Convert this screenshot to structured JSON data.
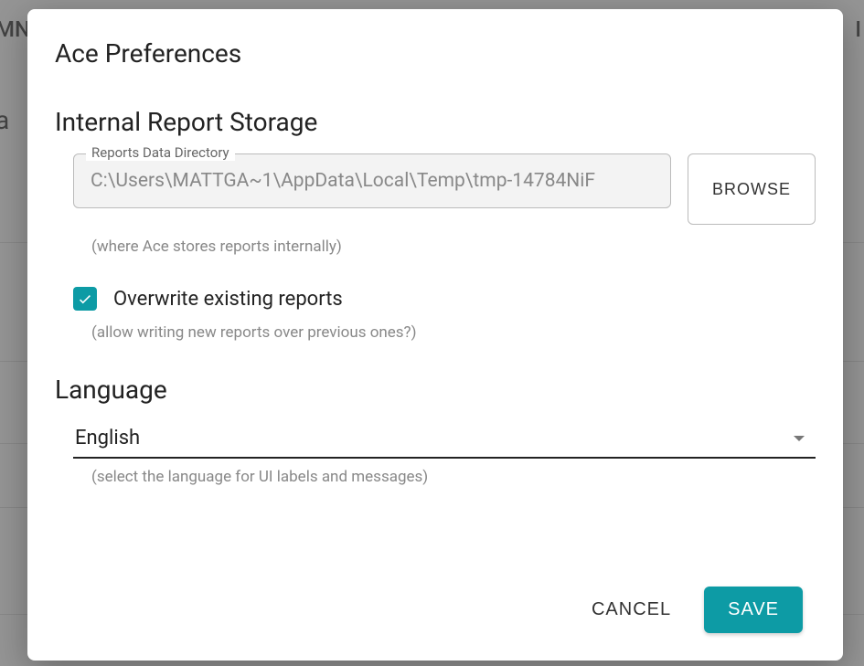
{
  "modal": {
    "title": "Ace Preferences",
    "storage": {
      "heading": "Internal Report Storage",
      "field_label": "Reports Data Directory",
      "directory_value": "C:\\Users\\MATTGA~1\\AppData\\Local\\Temp\\tmp-14784NiF",
      "browse_label": "BROWSE",
      "helper": "(where Ace stores reports internally)",
      "overwrite_label": "Overwrite existing reports",
      "overwrite_checked": true,
      "overwrite_helper": "(allow writing new reports over previous ones?)"
    },
    "language": {
      "heading": "Language",
      "selected": "English",
      "helper": "(select the language for UI labels and messages)"
    },
    "actions": {
      "cancel": "CANCEL",
      "save": "SAVE"
    }
  },
  "colors": {
    "accent": "#0d9ba5"
  },
  "background_fragments": {
    "top_left": "MN",
    "mid_left": "a",
    "top_right": "I"
  }
}
